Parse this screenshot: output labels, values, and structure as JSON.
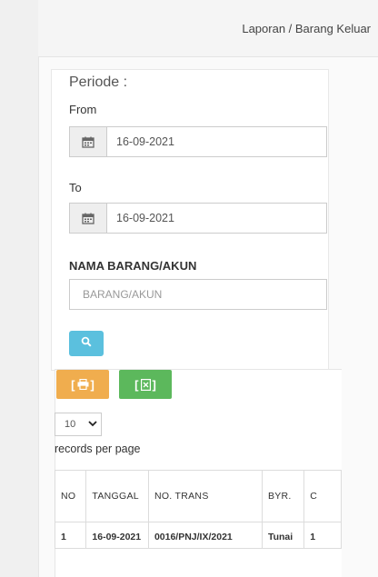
{
  "breadcrumb": "Laporan / Barang Keluar",
  "form": {
    "periode_title": "Periode :",
    "from_label": "From",
    "from_value": "16-09-2021",
    "to_label": "To",
    "to_value": "16-09-2021",
    "nama_label": "NAMA BARANG/AKUN",
    "nama_placeholder": "BARANG/AKUN"
  },
  "actions": {
    "search_icon": "search-icon",
    "print_icon": "print-icon",
    "excel_icon": "excel-icon",
    "colors": {
      "search": "#5bc0de",
      "print": "#f0ad4e",
      "excel": "#5cb85c"
    }
  },
  "table_controls": {
    "page_size": "10",
    "records_label": "records per page"
  },
  "table": {
    "headers": [
      "NO",
      "TANGGAL",
      "NO. TRANS",
      "BYR.",
      "C"
    ],
    "rows": [
      [
        "1",
        "16-09-2021",
        "0016/PNJ/IX/2021",
        "Tunai",
        "1"
      ]
    ]
  }
}
